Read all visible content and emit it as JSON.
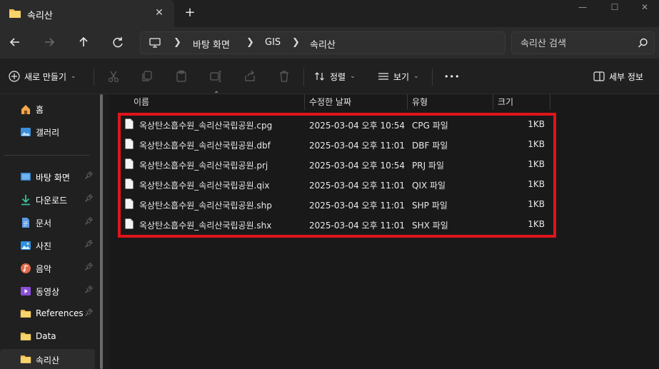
{
  "tab": {
    "title": "속리산"
  },
  "address": {
    "crumbs": [
      "바탕 화면",
      "GIS",
      "속리산"
    ]
  },
  "search": {
    "placeholder": "속리산 검색"
  },
  "commands": {
    "new_label": "새로 만들기",
    "sort_label": "정렬",
    "view_label": "보기",
    "more_label": "•••",
    "details_label": "세부 정보"
  },
  "sidebar": {
    "items": [
      {
        "label": "홈",
        "icon": "home-icon",
        "pinned": false
      },
      {
        "label": "갤러리",
        "icon": "gallery-icon",
        "pinned": false
      },
      {
        "label": "바탕 화면",
        "icon": "desktop-icon",
        "pinned": true
      },
      {
        "label": "다운로드",
        "icon": "download-icon",
        "pinned": true
      },
      {
        "label": "문서",
        "icon": "document-icon",
        "pinned": true
      },
      {
        "label": "사진",
        "icon": "pictures-icon",
        "pinned": true
      },
      {
        "label": "음악",
        "icon": "music-icon",
        "pinned": true
      },
      {
        "label": "동영상",
        "icon": "video-icon",
        "pinned": true
      },
      {
        "label": "References",
        "icon": "folder-icon",
        "pinned": true
      },
      {
        "label": "Data",
        "icon": "folder-icon",
        "pinned": false
      },
      {
        "label": "속리산",
        "icon": "folder-icon",
        "pinned": false
      }
    ]
  },
  "columns": {
    "name": "이름",
    "modified": "수정한 날짜",
    "type": "유형",
    "size": "크기"
  },
  "files": [
    {
      "name": "옥상탄소흡수원_속리산국립공원.cpg",
      "modified": "2025-03-04 오후 10:54",
      "type": "CPG 파일",
      "size": "1KB"
    },
    {
      "name": "옥상탄소흡수원_속리산국립공원.dbf",
      "modified": "2025-03-04 오후 11:01",
      "type": "DBF 파일",
      "size": "1KB"
    },
    {
      "name": "옥상탄소흡수원_속리산국립공원.prj",
      "modified": "2025-03-04 오후 10:54",
      "type": "PRJ 파일",
      "size": "1KB"
    },
    {
      "name": "옥상탄소흡수원_속리산국립공원.qix",
      "modified": "2025-03-04 오후 11:01",
      "type": "QIX 파일",
      "size": "1KB"
    },
    {
      "name": "옥상탄소흡수원_속리산국립공원.shp",
      "modified": "2025-03-04 오후 11:01",
      "type": "SHP 파일",
      "size": "1KB"
    },
    {
      "name": "옥상탄소흡수원_속리산국립공원.shx",
      "modified": "2025-03-04 오후 11:01",
      "type": "SHX 파일",
      "size": "1KB"
    }
  ],
  "colors": {
    "highlight": "#e0141b",
    "folder": "#f2c14e",
    "background": "#191919"
  }
}
